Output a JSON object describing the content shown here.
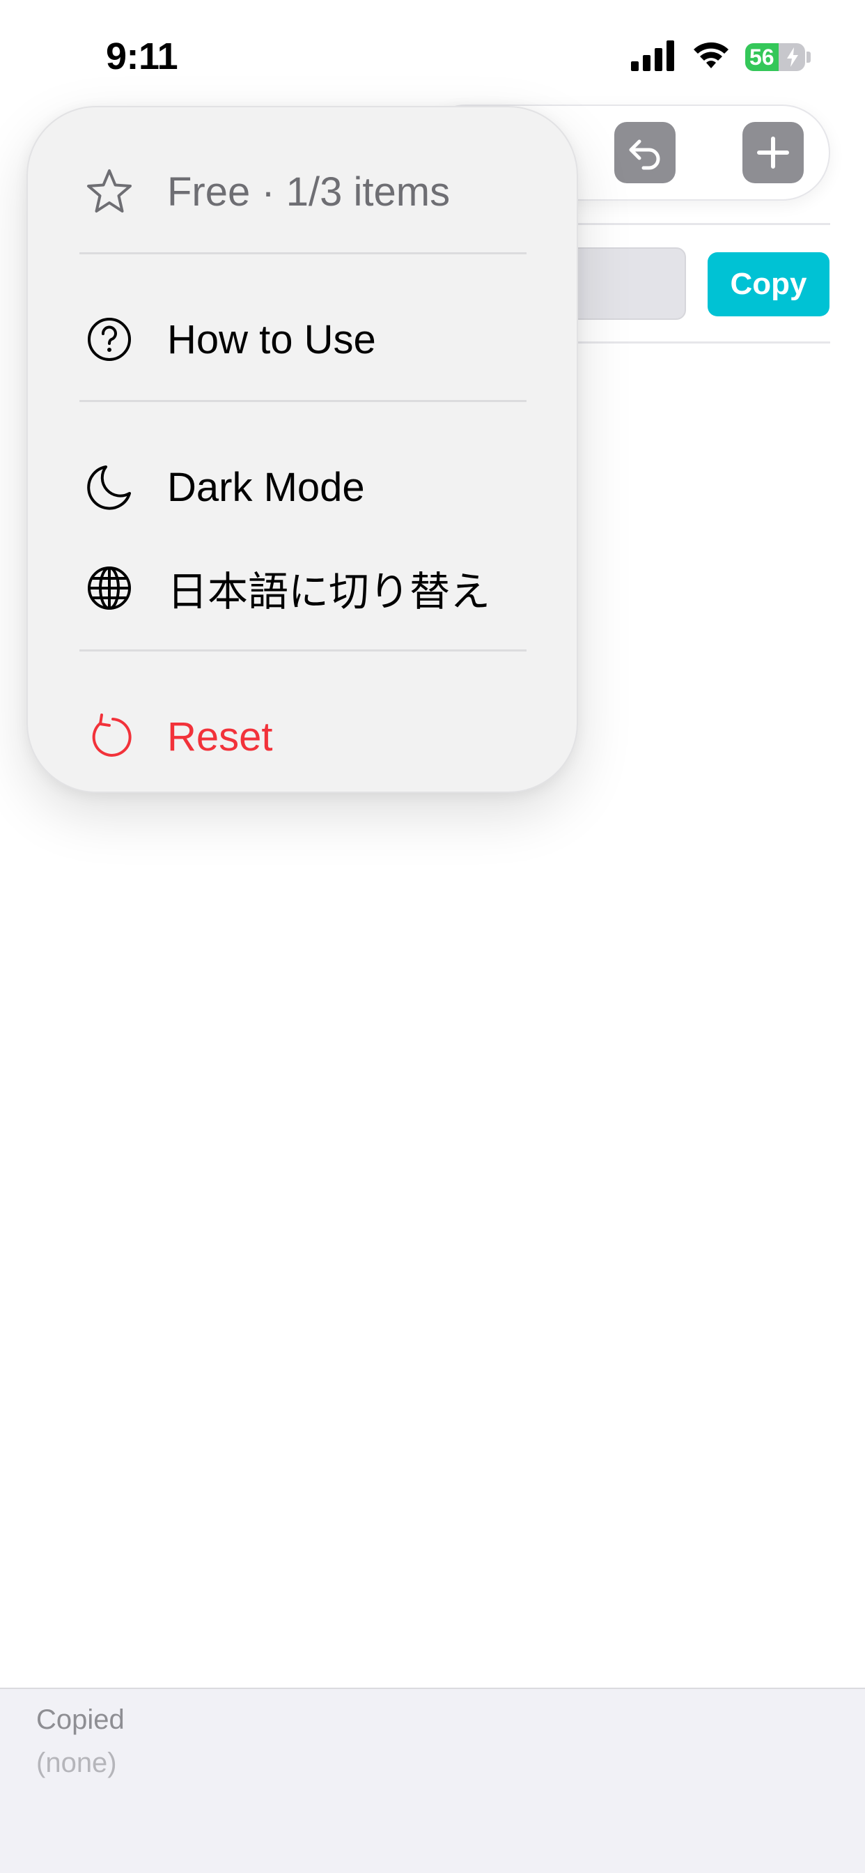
{
  "status_bar": {
    "time": "9:11",
    "battery_level": "56",
    "battery_fraction": 0.56,
    "battery_color": "#34c759"
  },
  "toolbar": {
    "undo_icon": "undo-arrow-icon",
    "add_icon": "plus-icon"
  },
  "input_row": {
    "value": "",
    "copy_label": "Copy",
    "accent_color": "#00c2d4"
  },
  "menu": {
    "plan": {
      "label": "Free · 1/3 items",
      "icon": "star-icon"
    },
    "how_to_use": {
      "label": "How to Use",
      "icon": "question-circle-icon"
    },
    "dark_mode": {
      "label": "Dark Mode",
      "icon": "moon-icon"
    },
    "language": {
      "label": "日本語に切り替え",
      "icon": "globe-icon"
    },
    "reset": {
      "label": "Reset",
      "icon": "reset-arrow-icon",
      "color": "#f2323a"
    }
  },
  "copied_panel": {
    "label": "Copied",
    "value": "(none)"
  }
}
